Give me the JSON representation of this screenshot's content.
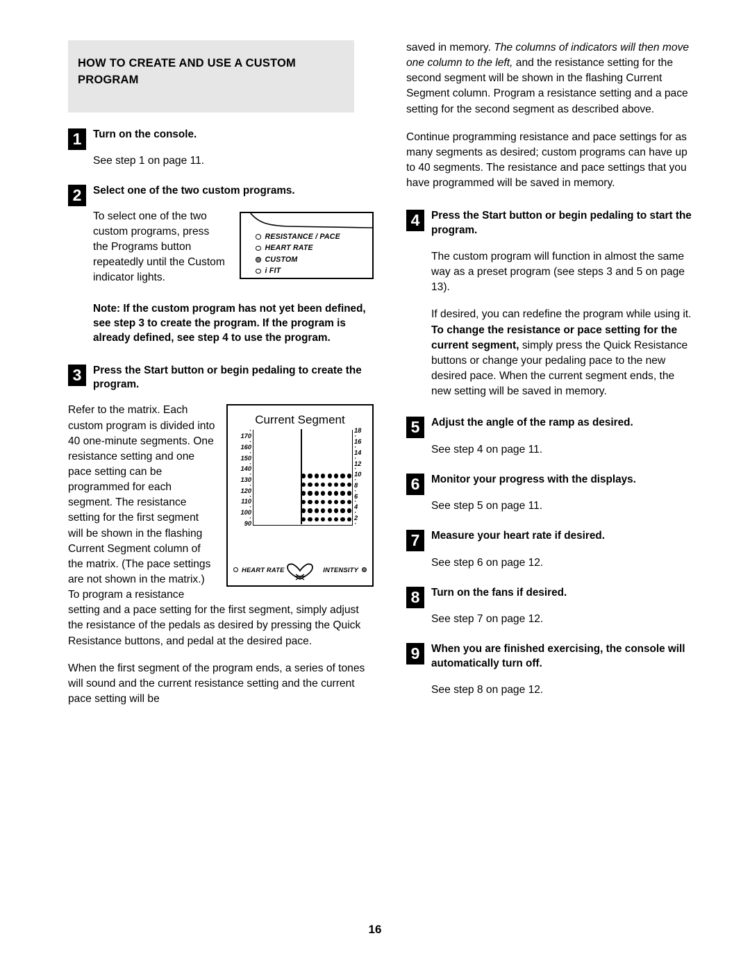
{
  "page": {
    "number": "16"
  },
  "section": {
    "heading": "HOW TO CREATE AND USE A CUSTOM PROGRAM"
  },
  "left_column": {
    "steps": [
      {
        "num": "1",
        "title": "Turn on the console.",
        "body": "See step 1 on page 11."
      },
      {
        "num": "2",
        "title": "Select one of the two custom programs.",
        "body": "To select one of the two custom programs, press the Programs button repeatedly until the Custom indicator lights."
      },
      {
        "num": "3",
        "title": "Press the Start button or begin pedaling to create the program.",
        "body_1": "Refer to the matrix. Each custom program is divided into 40 one-minute segments. One resistance setting and one pace setting can be programmed for each segment. The resistance setting for the first segment will be shown in the flashing Current Segment column of the matrix. (The pace settings are not shown in the matrix.) To program a resistance setting and a pace setting for the first segment, simply adjust the resistance of the pedals as desired by pressing the Quick Resistance buttons, and pedal at the desired pace.",
        "body_2": "When the first segment of the program ends, a series of tones will sound and the current resistance setting and the current pace setting will be"
      }
    ],
    "note": "Note: If the custom program has not yet been defined, see step 3 to create the program. If the program is already defined, see step 4 to use the program."
  },
  "right_column": {
    "continued_paragraph": {
      "pre": "saved in memory. ",
      "italic": "The columns of indicators will then move one column to the left,",
      "post": " and the resistance setting for the second segment will be shown in the flashing Current Segment column. Program a resistance setting and a pace setting for the second segment as described above."
    },
    "paragraph_2": "Continue programming resistance and pace settings for as many segments as desired; custom programs can have up to 40 segments. The resistance and pace settings that you have programmed will be saved in memory.",
    "steps": [
      {
        "num": "4",
        "title": "Press the Start button or begin pedaling to start the program.",
        "body_1": "The custom program will function in almost the same way as a preset program (see steps 3 and 5 on page 13).",
        "body_2_pre": "If desired, you can redefine the program while using it. ",
        "body_2_bold": "To change the resistance or pace setting for the current segment,",
        "body_2_post": " simply press the Quick Resistance buttons or change your pedaling pace to the new desired pace. When the current segment ends, the new setting will be saved in memory."
      },
      {
        "num": "5",
        "title": "Adjust the angle of the ramp as desired.",
        "body": "See step 4 on page 11."
      },
      {
        "num": "6",
        "title": "Monitor your progress with the displays.",
        "body": "See step 5 on page 11."
      },
      {
        "num": "7",
        "title": "Measure your heart rate if desired.",
        "body": "See step 6 on page 12."
      },
      {
        "num": "8",
        "title": "Turn on the fans if desired.",
        "body": "See step 7 on page 12."
      },
      {
        "num": "9",
        "title": "When you are finished exercising, the console will automatically turn off.",
        "body": "See step 8 on page 12."
      }
    ]
  },
  "console_figure": {
    "indicators": [
      {
        "label": "RESISTANCE / PACE",
        "lit": false
      },
      {
        "label": "HEART RATE",
        "lit": false
      },
      {
        "label": "CUSTOM",
        "lit": true
      },
      {
        "label": "i FIT",
        "lit": false
      }
    ]
  },
  "matrix_figure": {
    "title": "Current Segment",
    "left_scale": [
      "·",
      "170",
      "·",
      "160",
      "·",
      "150",
      "·",
      "140",
      "·",
      "130",
      "·",
      "120",
      "·",
      "110",
      "·",
      "100",
      "·",
      "90"
    ],
    "right_scale": [
      "18",
      "·",
      "16",
      "·",
      "14",
      "·",
      "12",
      "·",
      "10",
      "·",
      "8",
      "·",
      "6",
      "·",
      "4",
      "·",
      "2",
      "·"
    ],
    "dot_columns": 8,
    "dot_rows": 6,
    "footer_left_label": "HEART RATE",
    "footer_right_label": "INTENSITY",
    "footer_left_lit": false,
    "footer_right_lit": true
  },
  "colors": {
    "banner_bg": "#e6e6e6",
    "ink": "#000000",
    "led_on": "#808080",
    "paper": "#ffffff"
  }
}
